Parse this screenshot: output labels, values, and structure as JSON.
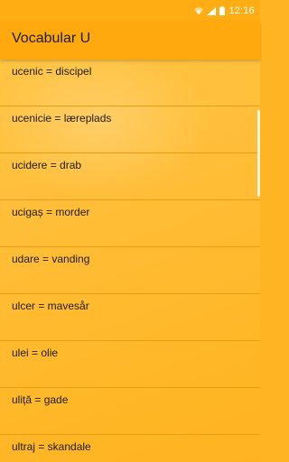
{
  "status_bar": {
    "time": "12:16",
    "icons": [
      "wifi-icon",
      "signal-icon",
      "battery-icon"
    ]
  },
  "app_bar": {
    "title": "Vocabular U"
  },
  "list": {
    "items": [
      {
        "label": "ucenic = discipel"
      },
      {
        "label": "ucenicie = læreplads"
      },
      {
        "label": "ucidere = drab"
      },
      {
        "label": "ucigaș = morder"
      },
      {
        "label": "udare = vanding"
      },
      {
        "label": "ulcer = mavesår"
      },
      {
        "label": "ulei = olie"
      },
      {
        "label": "uliță = gade"
      },
      {
        "label": "ultraj = skandale"
      }
    ]
  },
  "colors": {
    "status_bar": "#FFAD13",
    "app_bar": "#FFA90E",
    "background": "#FFBE38",
    "divider": "#E59E14"
  }
}
